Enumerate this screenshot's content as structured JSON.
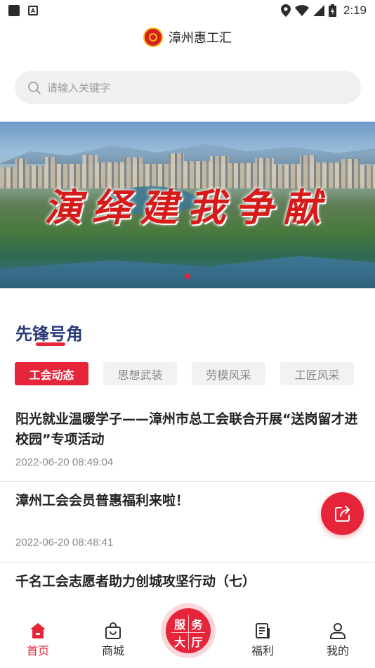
{
  "status_bar": {
    "time": "2:19"
  },
  "header": {
    "title": "漳州惠工汇"
  },
  "search": {
    "placeholder": "请输入关键字"
  },
  "banner": {
    "text": "演绎建我争献"
  },
  "section": {
    "title": "先锋号角"
  },
  "tabs": [
    {
      "label": "工会动态",
      "active": true
    },
    {
      "label": "思想武装",
      "active": false
    },
    {
      "label": "劳模风采",
      "active": false
    },
    {
      "label": "工匠风采",
      "active": false
    }
  ],
  "news": [
    {
      "title": "阳光就业温暖学子——漳州市总工会联合开展“送岗留才进校园”专项活动",
      "time": "2022-06-20 08:49:04"
    },
    {
      "title": "漳州工会会员普惠福利来啦！",
      "time": "2022-06-20 08:48:41"
    },
    {
      "title": "千名工会志愿者助力创城攻坚行动（七）",
      "time": ""
    }
  ],
  "bottom_nav": {
    "home": "首页",
    "mall": "商城",
    "service": [
      "服",
      "务",
      "大",
      "厅"
    ],
    "welfare": "福利",
    "mine": "我的"
  },
  "colors": {
    "accent": "#e6243a",
    "section_title": "#2b3a78"
  }
}
